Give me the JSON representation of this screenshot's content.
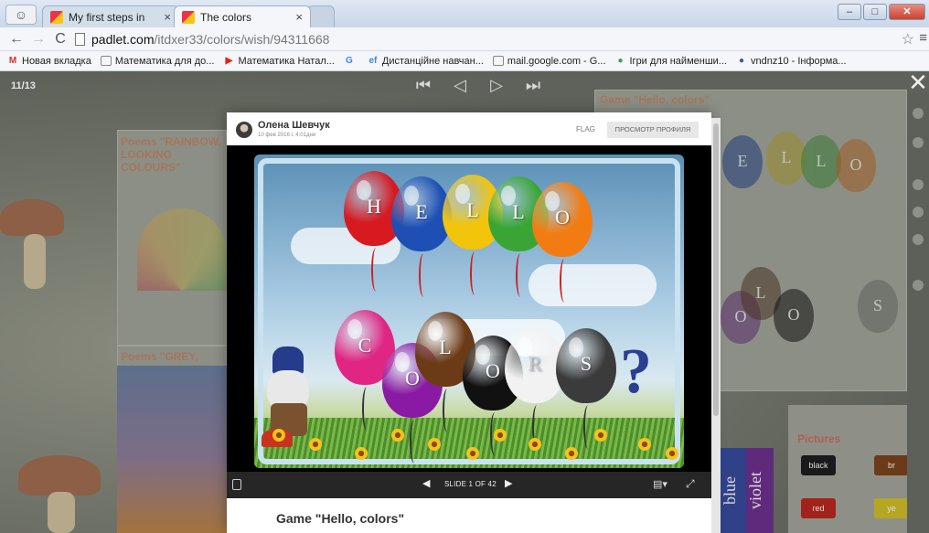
{
  "browser": {
    "tabs": [
      {
        "label": "My first steps in English",
        "close": "×"
      },
      {
        "label": "The colors",
        "close": "×"
      }
    ],
    "address": {
      "host": "padlet.com",
      "path": "/itdxer33/colors/wish/94311668"
    },
    "bookmarks": [
      {
        "label": "Новая вкладка",
        "icon": "gmail-icon",
        "glyph": "M",
        "color": "#d93025"
      },
      {
        "label": "Математика для до...",
        "icon": "page-icon",
        "glyph": "",
        "color": "#888888"
      },
      {
        "label": "Математика Натал...",
        "icon": "youtube-icon",
        "glyph": "▶",
        "color": "#e62117"
      },
      {
        "label": "",
        "icon": "google-icon",
        "glyph": "G",
        "color": "#4285f4"
      },
      {
        "label": "Дистанційне навчан...",
        "icon": "ef-icon",
        "glyph": "ef",
        "color": "#3a8fd6"
      },
      {
        "label": "mail.google.com - G...",
        "icon": "page-icon",
        "glyph": "",
        "color": "#888888"
      },
      {
        "label": "Ігри для наймен­ши...",
        "icon": "game-icon",
        "glyph": "●",
        "color": "#2aa84a"
      },
      {
        "label": "vndnz10 - Інформа...",
        "icon": "chrome-icon",
        "glyph": "●",
        "color": "#3b5998"
      }
    ]
  },
  "viewer": {
    "counter": "11/13",
    "post": {
      "author": "Олена Шевчук",
      "date": "10 фев 2016 г. 4:01дня",
      "flag": "FLAG",
      "profile_button": "ПРОСМОТР ПРОФИЛЯ",
      "title": "Game \"Hello, colors\""
    },
    "slideshow": {
      "counter": "SLIDE 1 OF 42"
    }
  },
  "slide": {
    "hello": [
      {
        "letter": "H",
        "color": "#d71920"
      },
      {
        "letter": "E",
        "color": "#1d4fb5"
      },
      {
        "letter": "L",
        "color": "#f2c40a"
      },
      {
        "letter": "L",
        "color": "#3aa535"
      },
      {
        "letter": "O",
        "color": "#f27c12"
      }
    ],
    "colors": [
      {
        "letter": "C",
        "color": "#e02583"
      },
      {
        "letter": "O",
        "color": "#8a1aa3"
      },
      {
        "letter": "L",
        "color": "#6b3a16"
      },
      {
        "letter": "O",
        "color": "#111111"
      },
      {
        "letter": "R",
        "color": "#f2f2f2"
      },
      {
        "letter": "S",
        "color": "#3b3b3b"
      }
    ],
    "question": "?"
  },
  "background": {
    "poems_rainbow": "Poems \"RAINBOW, LOOKING COLOURS\"",
    "poems_grey": "Poems \"GREY, BROWN, WHITE\"",
    "game_right": "Game \"Hello, colors\"",
    "pictures": "Pictures",
    "swatches": [
      "black",
      "br",
      "red",
      "ye"
    ],
    "violet_word": "violet",
    "blue_word": "blue"
  }
}
